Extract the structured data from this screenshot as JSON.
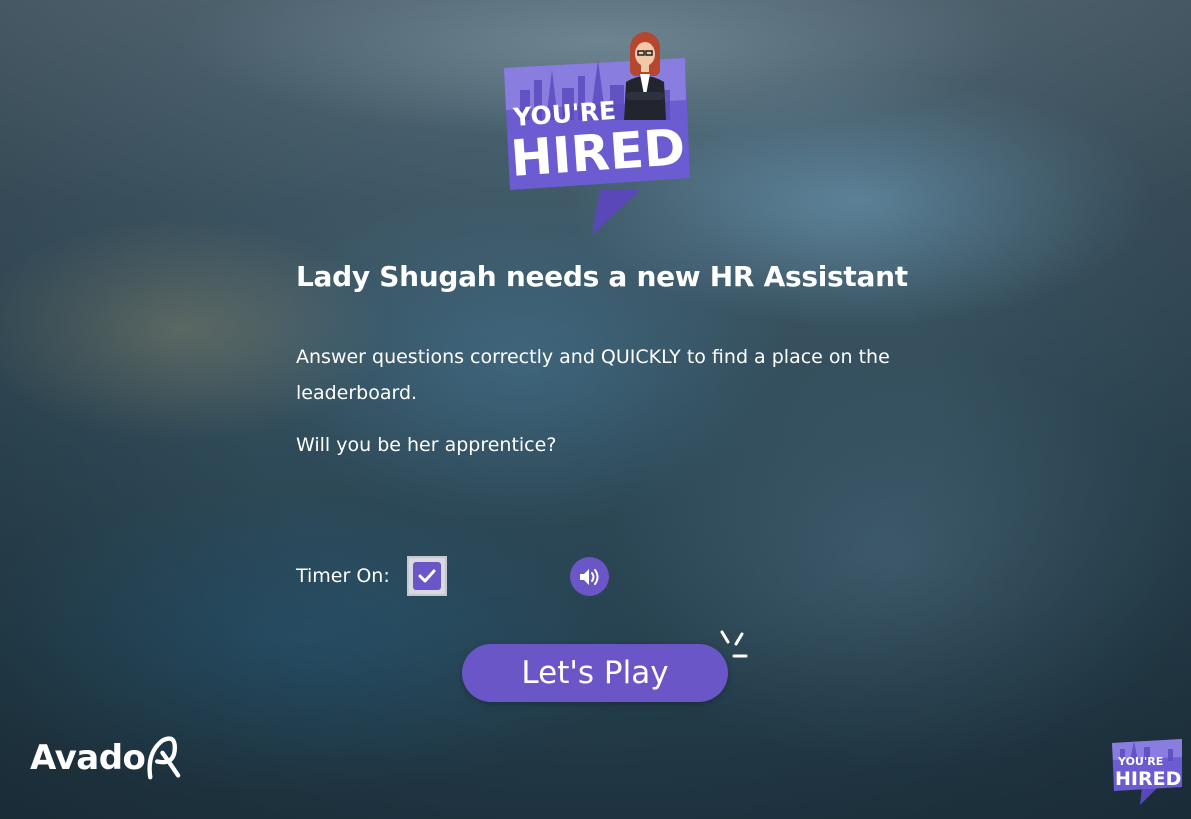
{
  "brand": {
    "game_logo_line1": "YOU'RE",
    "game_logo_line2": "HIRED",
    "company_logo": "Avado"
  },
  "intro": {
    "headline": "Lady Shugah needs a new HR Assistant",
    "description": "Answer questions correctly and QUICKLY to find a place on the leaderboard.",
    "question": "Will you be her apprentice?"
  },
  "settings": {
    "timer_label": "Timer On:",
    "timer_checked": true,
    "sound_icon": "volume-up-icon"
  },
  "actions": {
    "play_label": "Let's Play"
  },
  "colors": {
    "accent": "#6a56c6",
    "logo_purple": "#6b5cd1",
    "logo_light": "#9a8fe6"
  }
}
